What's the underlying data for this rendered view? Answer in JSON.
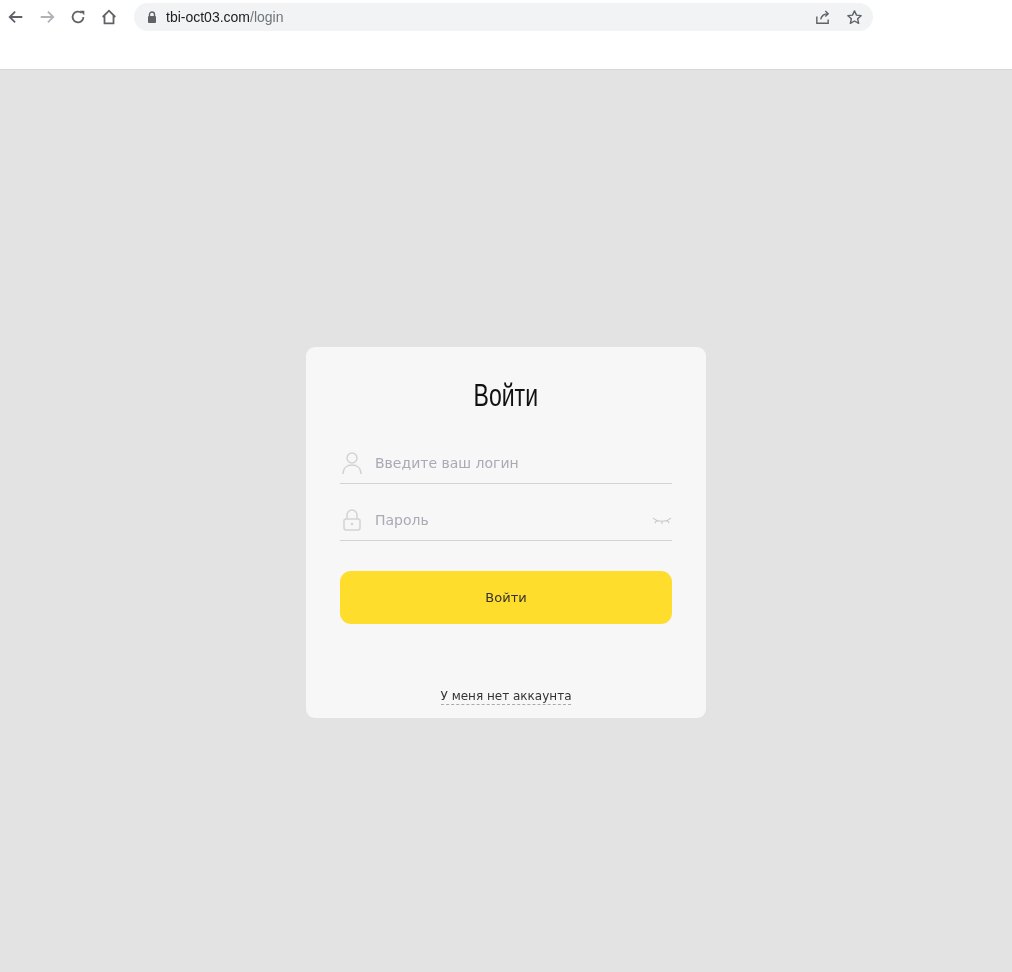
{
  "browser": {
    "url_host": "tbi-oct03.com",
    "url_path": "/login",
    "forward_disabled": true
  },
  "login": {
    "title": "Войти",
    "fields": [
      {
        "kind": "login",
        "placeholder": "Введите ваш логин"
      },
      {
        "kind": "password",
        "placeholder": "Пароль"
      }
    ],
    "submit": "Войти",
    "register_link": "У меня нет аккаунта"
  }
}
